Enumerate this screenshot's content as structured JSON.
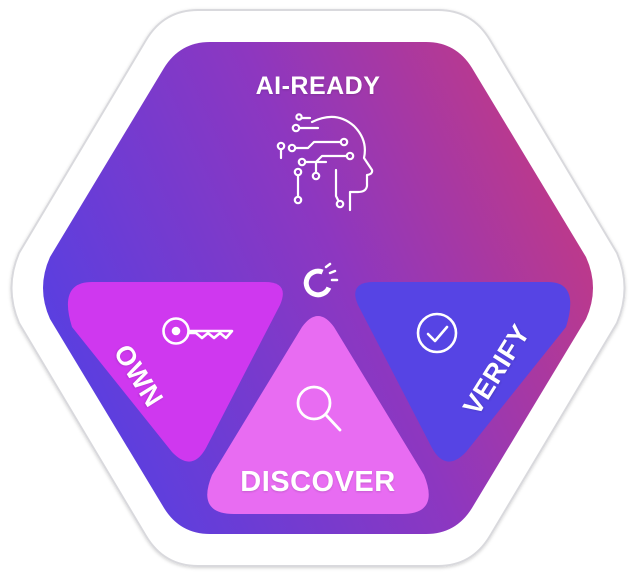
{
  "diagram": {
    "top_label": "AI-READY",
    "own_label": "OWN",
    "verify_label": "VERIFY",
    "discover_label": "DISCOVER"
  },
  "colors": {
    "outer_frame": "#ffffff",
    "frame_shadow": "#d9d9dd",
    "gradient_start": "#5a3fe0",
    "gradient_mid": "#8d37c0",
    "gradient_end": "#c93a7d",
    "own_panel": "#cf38ef",
    "verify_panel": "#5644e4",
    "discover_panel": "#e86cf2",
    "icon_stroke": "#ffffff"
  },
  "icons": {
    "top": "ai-head-circuit-icon",
    "own": "key-icon",
    "verify": "check-circle-icon",
    "discover": "magnifier-icon",
    "center": "brand-logo-icon"
  }
}
